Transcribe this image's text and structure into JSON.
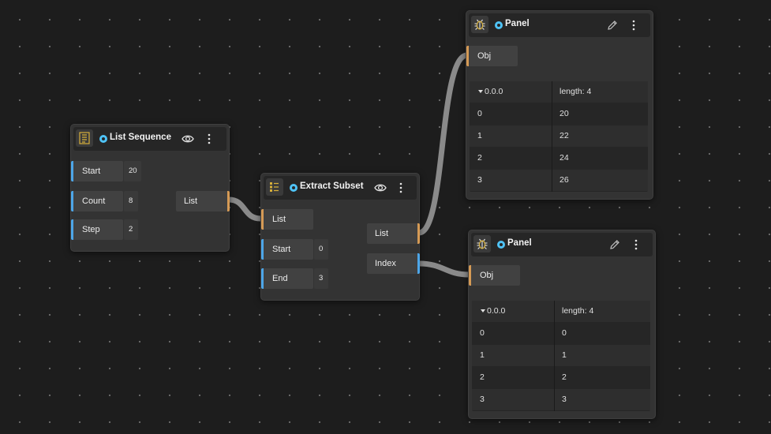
{
  "colors": {
    "canvas_bg": "#1d1d1d",
    "node_bg": "#333333",
    "header_bg": "#262626",
    "input_port_accent": "#4da6e8",
    "list_port_accent": "#d59a55",
    "wire": "#8a8a8a",
    "status_dot": "#4fc3f7"
  },
  "list_sequence": {
    "icon": "list-sequence-icon",
    "title": "List Sequence",
    "inputs": [
      {
        "label": "Start",
        "value": "20"
      },
      {
        "label": "Count",
        "value": "8"
      },
      {
        "label": "Step",
        "value": "2"
      }
    ],
    "outputs": [
      {
        "label": "List"
      }
    ]
  },
  "extract_subset": {
    "icon": "extract-subset-icon",
    "title": "Extract Subset",
    "inputs": [
      {
        "label": "List",
        "value": ""
      },
      {
        "label": "Start",
        "value": "0"
      },
      {
        "label": "End",
        "value": "3"
      }
    ],
    "outputs": [
      {
        "label": "List"
      },
      {
        "label": "Index"
      }
    ]
  },
  "panel_top": {
    "icon": "bug-icon",
    "title": "Panel",
    "input": "Obj",
    "table": {
      "header": [
        "0.0.0",
        "length: 4"
      ],
      "rows": [
        [
          "0",
          "20"
        ],
        [
          "1",
          "22"
        ],
        [
          "2",
          "24"
        ],
        [
          "3",
          "26"
        ]
      ]
    }
  },
  "panel_bottom": {
    "icon": "bug-icon",
    "title": "Panel",
    "input": "Obj",
    "table": {
      "header": [
        "0.0.0",
        "length: 4"
      ],
      "rows": [
        [
          "0",
          "0"
        ],
        [
          "1",
          "1"
        ],
        [
          "2",
          "2"
        ],
        [
          "3",
          "3"
        ]
      ]
    }
  }
}
